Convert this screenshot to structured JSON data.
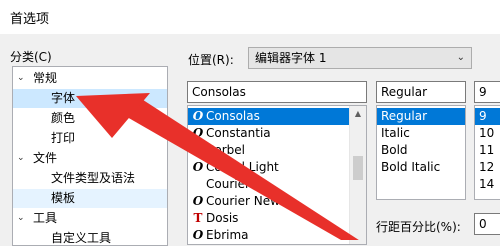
{
  "window": {
    "title": "首选项"
  },
  "category": {
    "label": "分类(C)",
    "items": [
      {
        "label": "常规",
        "level": 0,
        "expander": "⌄"
      },
      {
        "label": "字体",
        "level": 1,
        "selected": true
      },
      {
        "label": "颜色",
        "level": 1
      },
      {
        "label": "打印",
        "level": 1
      },
      {
        "label": "文件",
        "level": 0,
        "expander": "⌄"
      },
      {
        "label": "文件类型及语法",
        "level": 1
      },
      {
        "label": "模板",
        "level": 1,
        "hover": true
      },
      {
        "label": "工具",
        "level": 0,
        "expander": "⌄"
      },
      {
        "label": "自定义工具",
        "level": 1
      }
    ]
  },
  "position": {
    "label": "位置(R):",
    "value": "编辑器字体 1"
  },
  "font": {
    "input_value": "Consolas",
    "items": [
      {
        "name": "Consolas",
        "icon": "opentype-icon",
        "selected": true
      },
      {
        "name": "Constantia",
        "icon": "opentype-icon"
      },
      {
        "name": "Corbel",
        "icon": "opentype-icon"
      },
      {
        "name": "Corbel Light",
        "icon": "opentype-icon"
      },
      {
        "name": "Courier",
        "icon": "none"
      },
      {
        "name": "Courier New",
        "icon": "opentype-icon"
      },
      {
        "name": "Dosis",
        "icon": "truetype-icon"
      },
      {
        "name": "Ebrima",
        "icon": "opentype-icon"
      }
    ]
  },
  "style": {
    "input_value": "Regular",
    "items": [
      {
        "name": "Regular",
        "selected": true
      },
      {
        "name": "Italic"
      },
      {
        "name": "Bold"
      },
      {
        "name": "Bold Italic"
      }
    ]
  },
  "size": {
    "input_value": "9",
    "items": [
      {
        "value": "9",
        "selected": true
      },
      {
        "value": "10"
      },
      {
        "value": "11"
      },
      {
        "value": "12"
      },
      {
        "value": "14"
      }
    ]
  },
  "line_spacing": {
    "label": "行距百分比(%):",
    "value": "0"
  },
  "colors": {
    "selection": "#0078d7",
    "tree_selected": "#cce8ff",
    "annotation_arrow": "#e8302a"
  }
}
